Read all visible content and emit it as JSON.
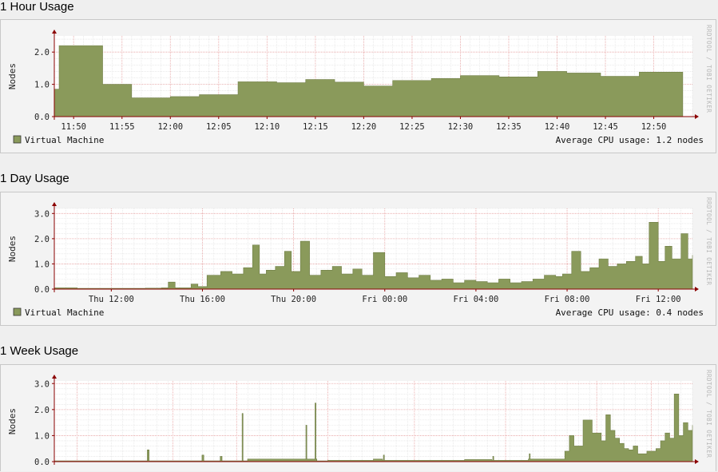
{
  "colors": {
    "area": "#8a9a5b",
    "area_stroke": "#6f7d45",
    "grid_major": "#e8a0a0",
    "grid_minor": "#dedede",
    "axis": "#8b0000",
    "plot_bg": "#ffffff",
    "legend_swatch": "#8a9a5b"
  },
  "watermark": "RRDTOOL / TOBI OETIKER",
  "chart_data": [
    {
      "id": "hour",
      "type": "area",
      "title": "1 Hour Usage",
      "ylabel": "Nodes",
      "ylim": [
        0,
        2.5
      ],
      "yticks": [
        "0.0",
        "1.0",
        "2.0"
      ],
      "ytick_values": [
        0,
        1,
        2
      ],
      "xlim": [
        11.8,
        12.9
      ],
      "xtick_labels": [
        "11:50",
        "11:55",
        "12:00",
        "12:05",
        "12:10",
        "12:15",
        "12:20",
        "12:25",
        "12:30",
        "12:35",
        "12:40",
        "12:45",
        "12:50"
      ],
      "xtick_values": [
        11.8333,
        11.9167,
        12.0,
        12.0833,
        12.1667,
        12.25,
        12.3333,
        12.4167,
        12.5,
        12.5833,
        12.6667,
        12.75,
        12.8333
      ],
      "series": [
        {
          "name": "Virtual Machine",
          "x": [
            11.8,
            11.8083,
            11.8833,
            11.9333,
            12.0,
            12.05,
            12.1167,
            12.1833,
            12.2333,
            12.2833,
            12.3333,
            12.3833,
            12.45,
            12.5,
            12.5667,
            12.6333,
            12.6833,
            12.7417,
            12.8083
          ],
          "y": [
            0.85,
            2.2,
            1.0,
            0.58,
            0.62,
            0.68,
            1.08,
            1.05,
            1.15,
            1.07,
            0.95,
            1.12,
            1.18,
            1.27,
            1.23,
            1.4,
            1.35,
            1.25,
            1.38
          ],
          "x_end": 12.8833
        }
      ],
      "legend": "Virtual Machine",
      "summary": "Average CPU usage: 1.2 nodes"
    },
    {
      "id": "day",
      "type": "area",
      "title": "1 Day Usage",
      "ylabel": "Nodes",
      "ylim": [
        0,
        3.2
      ],
      "yticks": [
        "0.0",
        "1.0",
        "2.0",
        "3.0"
      ],
      "ytick_values": [
        0,
        1,
        2,
        3
      ],
      "xlim": [
        9.5,
        37.5
      ],
      "xtick_labels": [
        "Thu 12:00",
        "Thu 16:00",
        "Thu 20:00",
        "Fri 00:00",
        "Fri 04:00",
        "Fri 08:00",
        "Fri 12:00"
      ],
      "xtick_values": [
        12,
        16,
        20,
        24,
        28,
        32,
        36
      ],
      "series": [
        {
          "name": "Virtual Machine",
          "x": [
            9.5,
            10.5,
            11.5,
            12.5,
            13.5,
            14.2,
            14.5,
            14.8,
            15.5,
            15.8,
            16.2,
            16.8,
            17.3,
            17.8,
            18.2,
            18.5,
            18.8,
            19.2,
            19.6,
            19.9,
            20.3,
            20.7,
            21.2,
            21.7,
            22.1,
            22.6,
            23.0,
            23.5,
            24.0,
            24.5,
            25.0,
            25.5,
            26.0,
            26.5,
            27.0,
            27.5,
            28.0,
            28.5,
            29.0,
            29.5,
            30.0,
            30.5,
            31.0,
            31.5,
            31.8,
            32.2,
            32.6,
            33.0,
            33.4,
            33.8,
            34.2,
            34.6,
            35.0,
            35.3,
            35.6,
            36.0,
            36.3,
            36.6,
            37.0,
            37.3,
            37.5
          ],
          "y": [
            0.05,
            0.03,
            0.03,
            0.03,
            0.04,
            0.05,
            0.28,
            0.05,
            0.2,
            0.1,
            0.55,
            0.7,
            0.6,
            0.85,
            1.75,
            0.6,
            0.75,
            0.9,
            1.5,
            0.7,
            1.9,
            0.55,
            0.75,
            0.9,
            0.6,
            0.8,
            0.55,
            1.45,
            0.5,
            0.65,
            0.45,
            0.55,
            0.35,
            0.4,
            0.25,
            0.35,
            0.3,
            0.25,
            0.4,
            0.25,
            0.3,
            0.4,
            0.55,
            0.5,
            0.6,
            1.5,
            0.7,
            0.85,
            1.2,
            0.9,
            1.0,
            1.1,
            1.3,
            1.0,
            2.65,
            1.1,
            1.7,
            1.2,
            2.2,
            1.2,
            1.35
          ],
          "x_end": 37.5
        }
      ],
      "legend": "Virtual Machine",
      "summary": "Average CPU usage: 0.4 nodes"
    },
    {
      "id": "week",
      "type": "area",
      "title": "1 Week Usage",
      "ylabel": "Nodes",
      "ylim": [
        0,
        3.1
      ],
      "yticks": [
        "0.0",
        "1.0",
        "2.0",
        "3.0"
      ],
      "ytick_values": [
        0,
        1,
        2,
        3
      ],
      "xlim": [
        0,
        7
      ],
      "xtick_labels": [],
      "xtick_values": [],
      "series": [
        {
          "name": "Virtual Machine",
          "x": [
            0.0,
            1.0,
            1.02,
            1.04,
            1.5,
            1.6,
            1.62,
            1.64,
            1.8,
            1.82,
            1.84,
            2.05,
            2.06,
            2.07,
            2.1,
            2.12,
            2.14,
            2.2,
            2.21,
            2.5,
            2.75,
            2.76,
            2.77,
            2.85,
            2.86,
            2.87,
            2.88,
            3.0,
            3.5,
            3.6,
            3.61,
            3.62,
            4.0,
            4.5,
            4.8,
            4.81,
            4.82,
            5.2,
            5.21,
            5.22,
            5.6,
            5.65,
            5.7,
            5.8,
            5.9,
            6.0,
            6.05,
            6.1,
            6.15,
            6.2,
            6.25,
            6.3,
            6.35,
            6.4,
            6.5,
            6.6,
            6.65,
            6.7,
            6.75,
            6.8,
            6.85,
            6.9,
            6.95,
            7.0
          ],
          "y": [
            0.03,
            0.03,
            0.45,
            0.03,
            0.03,
            0.03,
            0.25,
            0.03,
            0.03,
            0.2,
            0.03,
            0.03,
            1.85,
            0.03,
            0.03,
            0.1,
            0.1,
            0.1,
            0.1,
            0.1,
            0.1,
            1.4,
            0.1,
            0.1,
            2.25,
            0.1,
            0.03,
            0.05,
            0.1,
            0.05,
            0.25,
            0.05,
            0.05,
            0.08,
            0.05,
            0.2,
            0.05,
            0.1,
            0.3,
            0.1,
            0.4,
            1.0,
            0.6,
            1.6,
            1.1,
            0.8,
            1.8,
            1.2,
            0.9,
            0.7,
            0.5,
            0.45,
            0.6,
            0.3,
            0.4,
            0.5,
            0.8,
            1.1,
            0.9,
            2.6,
            1.0,
            1.5,
            1.2,
            1.4
          ],
          "x_end": 7.0
        }
      ],
      "legend": "",
      "summary": ""
    }
  ]
}
